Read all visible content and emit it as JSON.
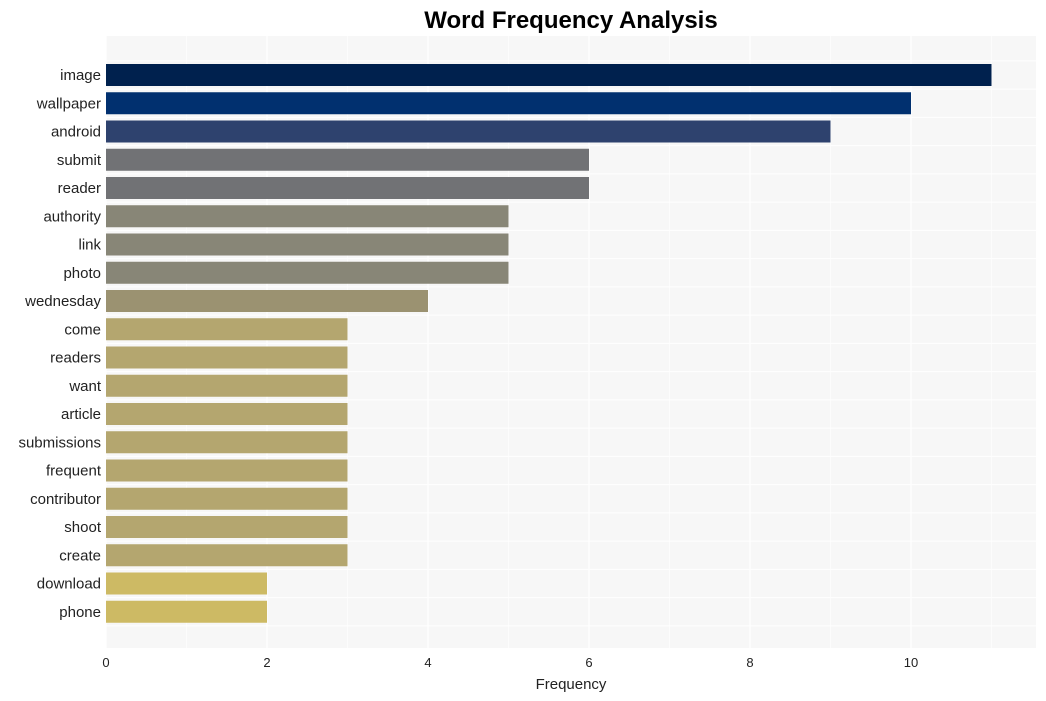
{
  "chart_data": {
    "type": "bar",
    "orientation": "horizontal",
    "title": "Word Frequency Analysis",
    "xlabel": "Frequency",
    "ylabel": "",
    "xlim": [
      0,
      11.55
    ],
    "xticks": [
      0,
      2,
      4,
      6,
      8,
      10
    ],
    "grid": true,
    "legend": "none",
    "categories": [
      "image",
      "wallpaper",
      "android",
      "submit",
      "reader",
      "authority",
      "link",
      "photo",
      "wednesday",
      "come",
      "readers",
      "want",
      "article",
      "submissions",
      "frequent",
      "contributor",
      "shoot",
      "create",
      "download",
      "phone"
    ],
    "values": [
      11,
      10,
      9,
      6,
      6,
      5,
      5,
      5,
      4,
      3,
      3,
      3,
      3,
      3,
      3,
      3,
      3,
      3,
      2,
      2
    ],
    "colors": [
      "#00214e",
      "#01306f",
      "#2e426e",
      "#717275",
      "#717275",
      "#888677",
      "#888677",
      "#888677",
      "#9b9271",
      "#b4a66f",
      "#b4a66f",
      "#b4a66f",
      "#b4a66f",
      "#b4a66f",
      "#b4a66f",
      "#b4a66f",
      "#b4a66f",
      "#b4a66f",
      "#cdba64",
      "#cdba64"
    ],
    "background": "#f7f7f7",
    "gridline_color": "#ffffff"
  }
}
